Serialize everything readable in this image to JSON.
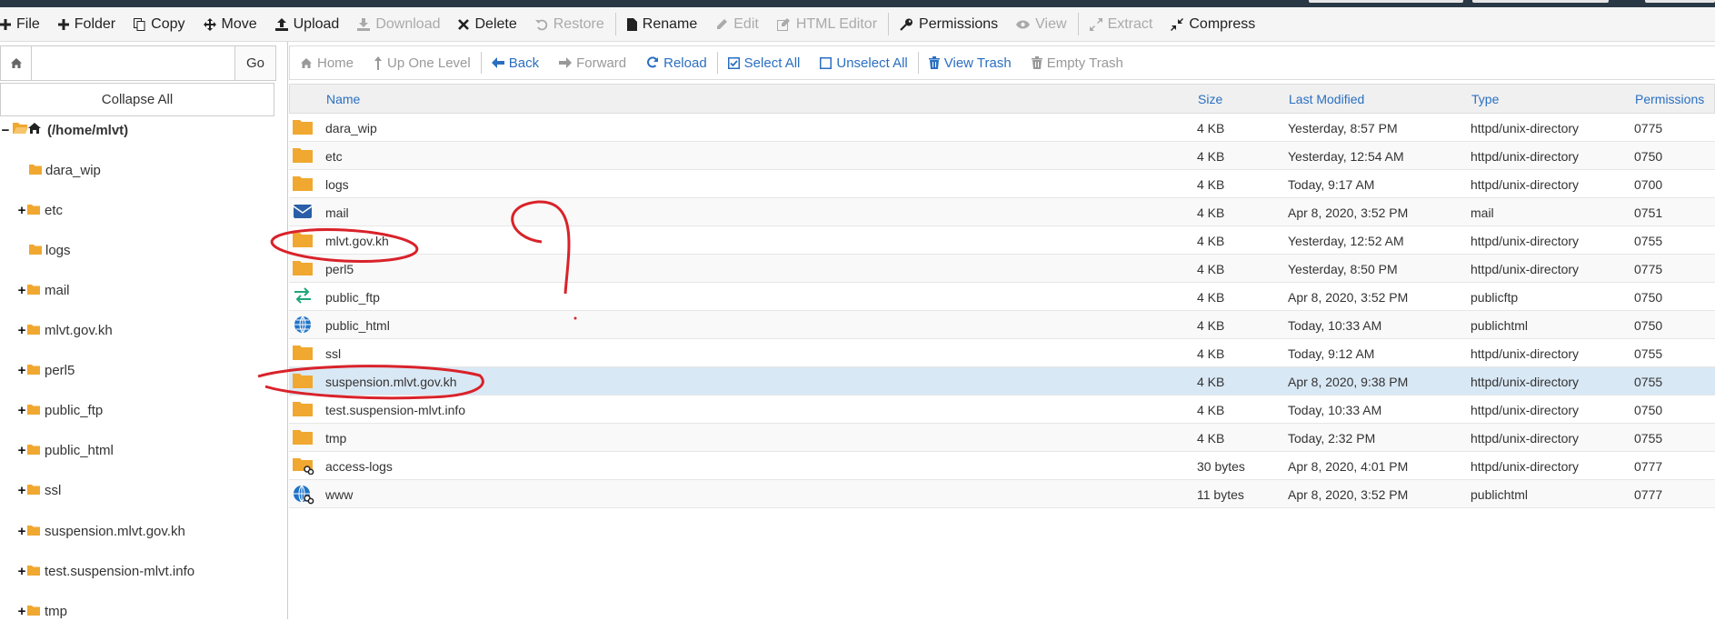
{
  "toolbar": {
    "items": [
      {
        "label": "File",
        "icon": "plus-icon",
        "disabled": false
      },
      {
        "label": "Folder",
        "icon": "plus-icon",
        "disabled": false
      },
      {
        "label": "Copy",
        "icon": "copy-icon",
        "disabled": false
      },
      {
        "label": "Move",
        "icon": "move-icon",
        "disabled": false
      },
      {
        "label": "Upload",
        "icon": "upload-icon",
        "disabled": false
      },
      {
        "label": "Download",
        "icon": "download-icon",
        "disabled": true
      },
      {
        "label": "Delete",
        "icon": "close-icon",
        "disabled": false
      },
      {
        "label": "Restore",
        "icon": "undo-icon",
        "disabled": true
      },
      {
        "label": "Rename",
        "icon": "file-icon",
        "disabled": false
      },
      {
        "label": "Edit",
        "icon": "pencil-icon",
        "disabled": true
      },
      {
        "label": "HTML Editor",
        "icon": "edit-box-icon",
        "disabled": true
      },
      {
        "label": "Permissions",
        "icon": "key-icon",
        "disabled": false
      },
      {
        "label": "View",
        "icon": "eye-icon",
        "disabled": true
      },
      {
        "label": "Extract",
        "icon": "expand-icon",
        "disabled": true
      },
      {
        "label": "Compress",
        "icon": "compress-icon",
        "disabled": false
      }
    ]
  },
  "left": {
    "go_label": "Go",
    "path_value": "",
    "collapse_label": "Collapse All",
    "tree": [
      {
        "label": "(/home/mlvt)",
        "toggle": "−",
        "root": true
      },
      {
        "label": "dara_wip",
        "toggle": ""
      },
      {
        "label": "etc",
        "toggle": "+"
      },
      {
        "label": "logs",
        "toggle": ""
      },
      {
        "label": "mail",
        "toggle": "+"
      },
      {
        "label": "mlvt.gov.kh",
        "toggle": "+"
      },
      {
        "label": "perl5",
        "toggle": "+"
      },
      {
        "label": "public_ftp",
        "toggle": "+"
      },
      {
        "label": "public_html",
        "toggle": "+"
      },
      {
        "label": "ssl",
        "toggle": "+"
      },
      {
        "label": "suspension.mlvt.gov.kh",
        "toggle": "+"
      },
      {
        "label": "test.suspension-mlvt.info",
        "toggle": "+"
      },
      {
        "label": "tmp",
        "toggle": "+"
      }
    ]
  },
  "nav": {
    "items": [
      {
        "label": "Home",
        "icon": "home-icon",
        "disabled": true
      },
      {
        "label": "Up One Level",
        "icon": "level-up-icon",
        "disabled": true
      },
      {
        "label": "Back",
        "icon": "arrow-left-icon",
        "disabled": false
      },
      {
        "label": "Forward",
        "icon": "arrow-right-icon",
        "disabled": true
      },
      {
        "label": "Reload",
        "icon": "reload-icon",
        "disabled": false
      },
      {
        "label": "Select All",
        "icon": "checkbox-checked-icon",
        "disabled": false
      },
      {
        "label": "Unselect All",
        "icon": "checkbox-empty-icon",
        "disabled": false
      },
      {
        "label": "View Trash",
        "icon": "trash-icon",
        "disabled": false
      },
      {
        "label": "Empty Trash",
        "icon": "trash-icon",
        "disabled": true
      }
    ]
  },
  "table": {
    "headers": {
      "name": "Name",
      "size": "Size",
      "modified": "Last Modified",
      "type": "Type",
      "perms": "Permissions"
    },
    "rows": [
      {
        "name": "dara_wip",
        "size": "4 KB",
        "modified": "Yesterday, 8:57 PM",
        "type": "httpd/unix-directory",
        "perms": "0775",
        "icon": "folder-icon"
      },
      {
        "name": "etc",
        "size": "4 KB",
        "modified": "Yesterday, 12:54 AM",
        "type": "httpd/unix-directory",
        "perms": "0750",
        "icon": "folder-icon"
      },
      {
        "name": "logs",
        "size": "4 KB",
        "modified": "Today, 9:17 AM",
        "type": "httpd/unix-directory",
        "perms": "0700",
        "icon": "folder-icon"
      },
      {
        "name": "mail",
        "size": "4 KB",
        "modified": "Apr 8, 2020, 3:52 PM",
        "type": "mail",
        "perms": "0751",
        "icon": "envelope-icon"
      },
      {
        "name": "mlvt.gov.kh",
        "size": "4 KB",
        "modified": "Yesterday, 12:52 AM",
        "type": "httpd/unix-directory",
        "perms": "0755",
        "icon": "folder-icon"
      },
      {
        "name": "perl5",
        "size": "4 KB",
        "modified": "Yesterday, 8:50 PM",
        "type": "httpd/unix-directory",
        "perms": "0775",
        "icon": "folder-icon"
      },
      {
        "name": "public_ftp",
        "size": "4 KB",
        "modified": "Apr 8, 2020, 3:52 PM",
        "type": "publicftp",
        "perms": "0750",
        "icon": "transfer-icon"
      },
      {
        "name": "public_html",
        "size": "4 KB",
        "modified": "Today, 10:33 AM",
        "type": "publichtml",
        "perms": "0750",
        "icon": "globe-icon"
      },
      {
        "name": "ssl",
        "size": "4 KB",
        "modified": "Today, 9:12 AM",
        "type": "httpd/unix-directory",
        "perms": "0755",
        "icon": "folder-icon"
      },
      {
        "name": "suspension.mlvt.gov.kh",
        "size": "4 KB",
        "modified": "Apr 8, 2020, 9:38 PM",
        "type": "httpd/unix-directory",
        "perms": "0755",
        "icon": "folder-icon",
        "selected": true
      },
      {
        "name": "test.suspension-mlvt.info",
        "size": "4 KB",
        "modified": "Today, 10:33 AM",
        "type": "httpd/unix-directory",
        "perms": "0750",
        "icon": "folder-icon"
      },
      {
        "name": "tmp",
        "size": "4 KB",
        "modified": "Today, 2:32 PM",
        "type": "httpd/unix-directory",
        "perms": "0755",
        "icon": "folder-icon"
      },
      {
        "name": "access-logs",
        "size": "30 bytes",
        "modified": "Apr 8, 2020, 4:01 PM",
        "type": "httpd/unix-directory",
        "perms": "0777",
        "icon": "folder-link-icon"
      },
      {
        "name": "www",
        "size": "11 bytes",
        "modified": "Apr 8, 2020, 3:52 PM",
        "type": "publichtml",
        "perms": "0777",
        "icon": "globe-link-icon"
      }
    ]
  },
  "colors": {
    "accent": "#2a6fc1",
    "folder": "#f0a830",
    "selected_row": "#d9e8f5",
    "annotation": "#d9222a",
    "topbar": "#2a3846"
  }
}
